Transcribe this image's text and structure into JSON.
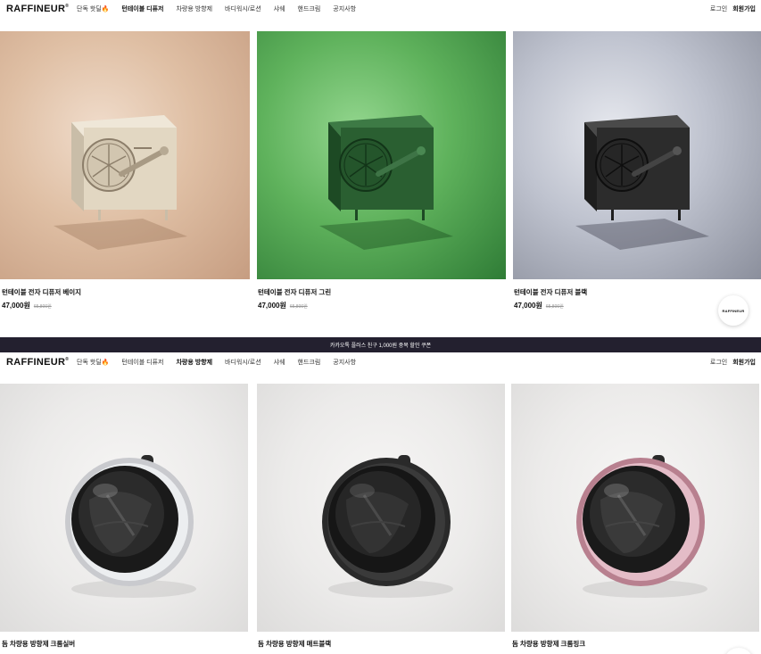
{
  "brand": {
    "logo": "RAFFINEUR"
  },
  "nav_top": {
    "items": [
      {
        "label": "단독 핫딜🔥",
        "active": false
      },
      {
        "label": "턴테이블 디퓨저",
        "active": true
      },
      {
        "label": "차량용 방향제",
        "active": false
      },
      {
        "label": "바디워시/로션",
        "active": false
      },
      {
        "label": "샤쉐",
        "active": false
      },
      {
        "label": "핸드크림",
        "active": false
      },
      {
        "label": "공지사항",
        "active": false
      }
    ],
    "login": "로그인",
    "signup": "회원가입"
  },
  "products_top": [
    {
      "name": "턴테이블 전자 디퓨저 베이지",
      "price": "47,000원",
      "original_price": "65,800원",
      "color": "beige"
    },
    {
      "name": "턴테이블 전자 디퓨저 그린",
      "price": "47,000원",
      "original_price": "65,800원",
      "color": "green"
    },
    {
      "name": "턴테이블 전자 디퓨저 블랙",
      "price": "47,000원",
      "original_price": "65,800원",
      "color": "black"
    }
  ],
  "floating_badge": {
    "label": "RAFFINEUR"
  },
  "banner": {
    "text": "카카오톡 플러스 친구 1,000원 중복 할인 쿠폰"
  },
  "nav_bottom": {
    "items": [
      {
        "label": "단독 핫딜🔥",
        "active": false
      },
      {
        "label": "턴테이블 디퓨저",
        "active": false
      },
      {
        "label": "차량용 방향제",
        "active": true
      },
      {
        "label": "바디워시/로션",
        "active": false
      },
      {
        "label": "샤쉐",
        "active": false
      },
      {
        "label": "핸드크림",
        "active": false
      },
      {
        "label": "공지사항",
        "active": false
      }
    ],
    "login": "로그인",
    "signup": "회원가입"
  },
  "products_bottom": [
    {
      "name": "돔 차량용 방향제 크롬실버",
      "ring_color": "#c9cace"
    },
    {
      "name": "돔 차량용 방향제 매트블랙",
      "ring_color": "#2a2a2a"
    },
    {
      "name": "돔 차량용 방향제 크롬핑크",
      "ring_color": "#d8a5b4"
    }
  ],
  "colors": {
    "banner_bg": "#23202f",
    "sale_fire": "#f07d1c"
  }
}
